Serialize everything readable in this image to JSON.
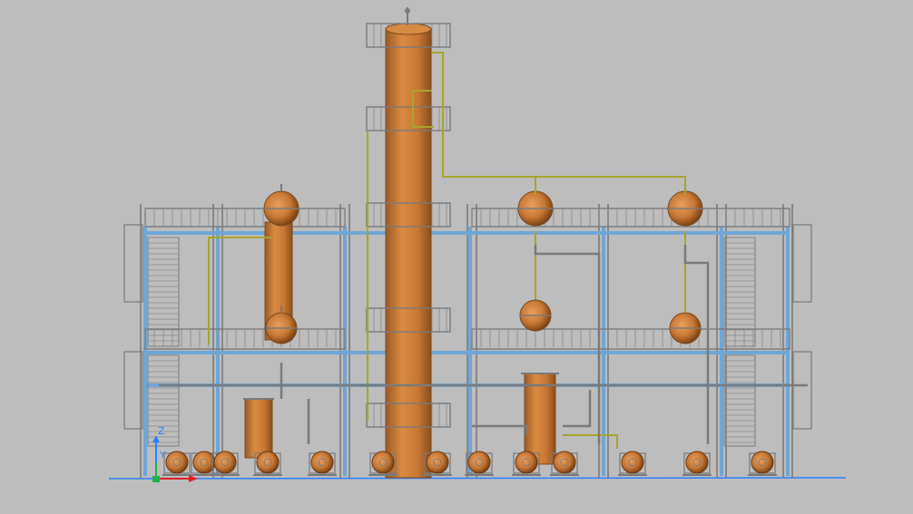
{
  "viewport": {
    "background": "#bdbdbd",
    "view_direction": "front elevation"
  },
  "ucs": {
    "axis_z_label": "Z",
    "axis_y_label": "Y",
    "axis_x_color": "#e0202a",
    "axis_y_color": "#22b14c",
    "axis_z_color": "#2a7fff"
  },
  "model": {
    "steel_color": "#6ea6d6",
    "vessel_color": "#c87834",
    "pipe_color": "#a8a42c",
    "railing_color": "#7a7a7a",
    "components": [
      "distillation-column",
      "platform-structure",
      "condenser-vessel",
      "reflux-drum",
      "reboiler",
      "pump"
    ]
  }
}
